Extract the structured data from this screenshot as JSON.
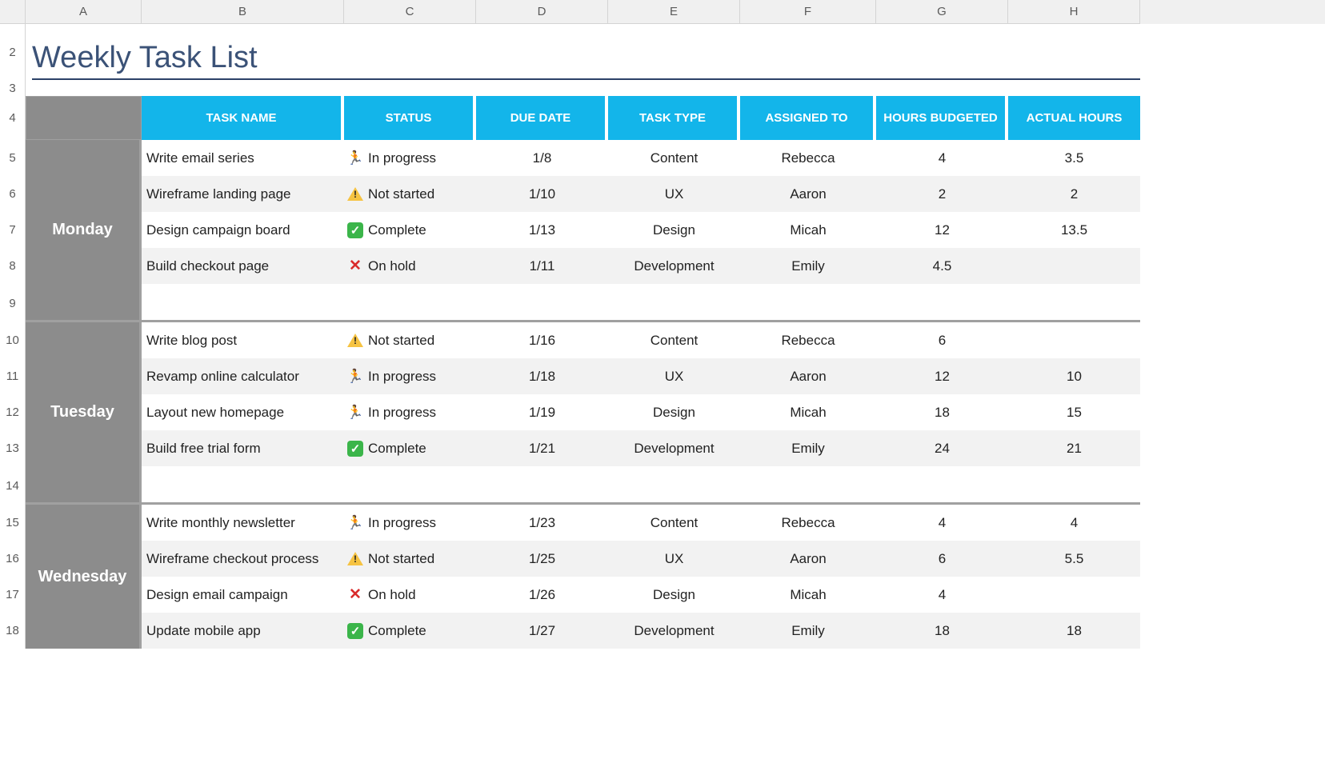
{
  "columns": [
    "A",
    "B",
    "C",
    "D",
    "E",
    "F",
    "G",
    "H"
  ],
  "row_numbers": [
    "",
    "2",
    "3",
    "4",
    "5",
    "6",
    "7",
    "8",
    "9",
    "10",
    "11",
    "12",
    "13",
    "14",
    "15",
    "16",
    "17",
    "18"
  ],
  "title": "Weekly Task List",
  "headers": {
    "task_name": "TASK NAME",
    "status": "STATUS",
    "due_date": "DUE DATE",
    "task_type": "TASK TYPE",
    "assigned_to": "ASSIGNED TO",
    "hours_budgeted": "HOURS BUDGETED",
    "actual_hours": "ACTUAL HOURS"
  },
  "status_labels": {
    "in_progress": "In progress",
    "not_started": "Not started",
    "complete": "Complete",
    "on_hold": "On hold"
  },
  "days": [
    {
      "name": "Monday",
      "rows": [
        {
          "task": "Write email series",
          "status": "in_progress",
          "due": "1/8",
          "type": "Content",
          "assigned": "Rebecca",
          "budget": "4",
          "actual": "3.5"
        },
        {
          "task": "Wireframe landing page",
          "status": "not_started",
          "due": "1/10",
          "type": "UX",
          "assigned": "Aaron",
          "budget": "2",
          "actual": "2"
        },
        {
          "task": "Design campaign board",
          "status": "complete",
          "due": "1/13",
          "type": "Design",
          "assigned": "Micah",
          "budget": "12",
          "actual": "13.5"
        },
        {
          "task": "Build checkout page",
          "status": "on_hold",
          "due": "1/11",
          "type": "Development",
          "assigned": "Emily",
          "budget": "4.5",
          "actual": ""
        },
        {
          "task": "",
          "status": "",
          "due": "",
          "type": "",
          "assigned": "",
          "budget": "",
          "actual": ""
        }
      ]
    },
    {
      "name": "Tuesday",
      "rows": [
        {
          "task": "Write blog post",
          "status": "not_started",
          "due": "1/16",
          "type": "Content",
          "assigned": "Rebecca",
          "budget": "6",
          "actual": ""
        },
        {
          "task": "Revamp online calculator",
          "status": "in_progress",
          "due": "1/18",
          "type": "UX",
          "assigned": "Aaron",
          "budget": "12",
          "actual": "10"
        },
        {
          "task": "Layout new homepage",
          "status": "in_progress",
          "due": "1/19",
          "type": "Design",
          "assigned": "Micah",
          "budget": "18",
          "actual": "15"
        },
        {
          "task": "Build free trial form",
          "status": "complete",
          "due": "1/21",
          "type": "Development",
          "assigned": "Emily",
          "budget": "24",
          "actual": "21"
        },
        {
          "task": "",
          "status": "",
          "due": "",
          "type": "",
          "assigned": "",
          "budget": "",
          "actual": ""
        }
      ]
    },
    {
      "name": "Wednesday",
      "rows": [
        {
          "task": "Write monthly newsletter",
          "status": "in_progress",
          "due": "1/23",
          "type": "Content",
          "assigned": "Rebecca",
          "budget": "4",
          "actual": "4"
        },
        {
          "task": "Wireframe checkout process",
          "status": "not_started",
          "due": "1/25",
          "type": "UX",
          "assigned": "Aaron",
          "budget": "6",
          "actual": "5.5"
        },
        {
          "task": "Design email campaign",
          "status": "on_hold",
          "due": "1/26",
          "type": "Design",
          "assigned": "Micah",
          "budget": "4",
          "actual": ""
        },
        {
          "task": "Update mobile app",
          "status": "complete",
          "due": "1/27",
          "type": "Development",
          "assigned": "Emily",
          "budget": "18",
          "actual": "18"
        }
      ]
    }
  ]
}
